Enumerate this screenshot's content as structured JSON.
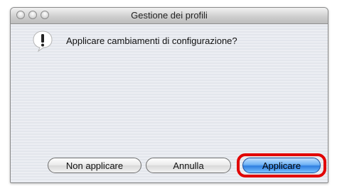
{
  "window": {
    "title": "Gestione dei profili"
  },
  "dialog": {
    "message": "Applicare cambiamenti di configurazione?",
    "icon": "alert-icon"
  },
  "buttons": {
    "dont_apply": "Non applicare",
    "cancel": "Annulla",
    "apply": "Applicare"
  },
  "colors": {
    "highlight": "#e10000",
    "default_button": "#2f7fe0"
  }
}
